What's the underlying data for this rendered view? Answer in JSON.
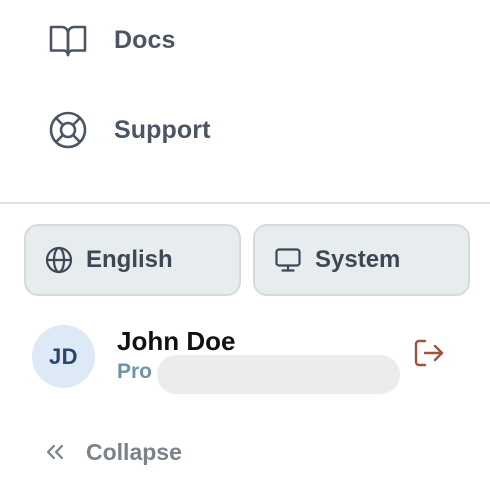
{
  "nav": {
    "docs": {
      "label": "Docs",
      "icon": "book-open-icon"
    },
    "support": {
      "label": "Support",
      "icon": "life-buoy-icon"
    }
  },
  "preferences": {
    "language": {
      "label": "English",
      "icon": "globe-icon"
    },
    "theme": {
      "label": "System",
      "icon": "monitor-icon"
    }
  },
  "user": {
    "initials": "JD",
    "name": "John Doe",
    "plan": "Pro"
  },
  "footer": {
    "collapse_label": "Collapse",
    "collapse_icon": "chevrons-left-icon",
    "logout_icon": "log-out-icon"
  },
  "colors": {
    "nav_text": "#4b5563",
    "pill_bg": "#e7ecef",
    "avatar_bg": "#dde9f6",
    "plan_text": "#6f94a8",
    "logout_accent": "#a0523f"
  }
}
